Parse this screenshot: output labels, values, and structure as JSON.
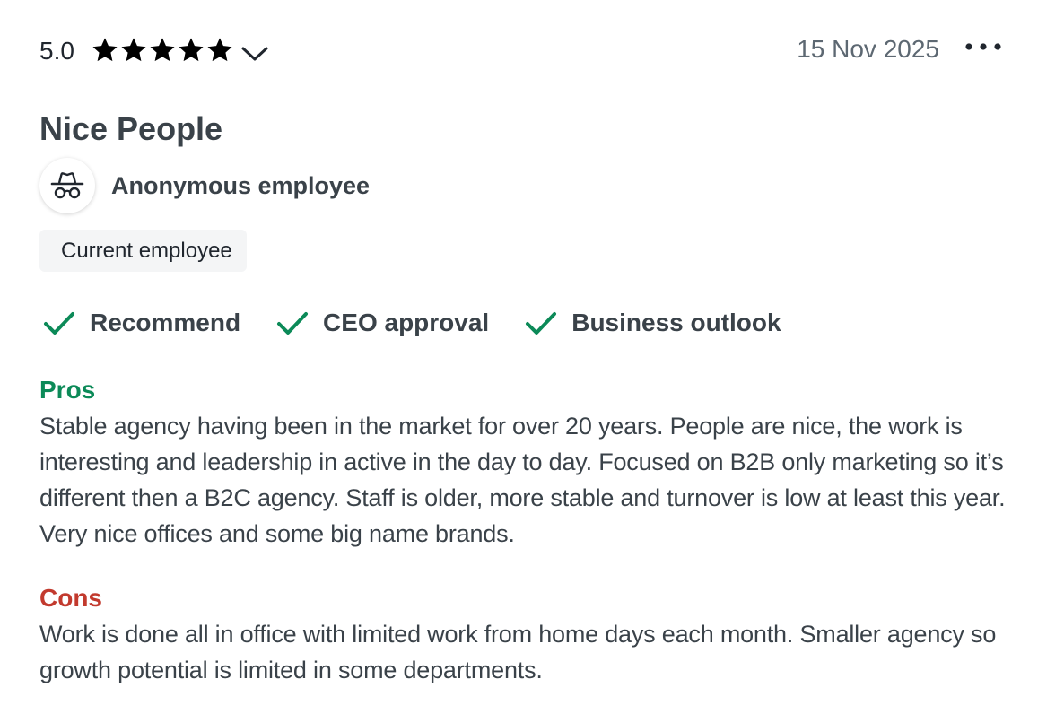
{
  "review": {
    "rating": "5.0",
    "stars_filled": 5,
    "stars_total": 5,
    "date": "15 Nov 2025",
    "title": "Nice People",
    "author": "Anonymous employee",
    "employment_status": "Current employee",
    "badges": [
      {
        "label": "Recommend",
        "icon": "check-icon",
        "color": "#0c8a58"
      },
      {
        "label": "CEO approval",
        "icon": "check-icon",
        "color": "#0c8a58"
      },
      {
        "label": "Business outlook",
        "icon": "check-icon",
        "color": "#0c8a58"
      }
    ],
    "pros": {
      "heading": "Pros",
      "text": "Stable agency having been in the market for over 20 years. People are nice, the work is interesting and leadership in active in the day to day. Focused on B2B only marketing so it’s different then a B2C agency. Staff is older, more stable and turnover is low at least this year. Very nice offices and some big name brands."
    },
    "cons": {
      "heading": "Cons",
      "text": "Work is done all in office with limited work from home days each month. Smaller agency so growth potential is limited in some departments."
    }
  },
  "colors": {
    "text_primary": "#3a4249",
    "text_muted": "#5d6872",
    "pros_green": "#0c8a58",
    "cons_red": "#c23a2e",
    "chip_bg": "#f4f5f6",
    "star": "#000000"
  },
  "icons": {
    "star": "star-icon",
    "expand": "chevron-down-icon",
    "menu": "more-horizontal-icon",
    "avatar": "anonymous-incognito-icon",
    "check": "check-icon"
  }
}
